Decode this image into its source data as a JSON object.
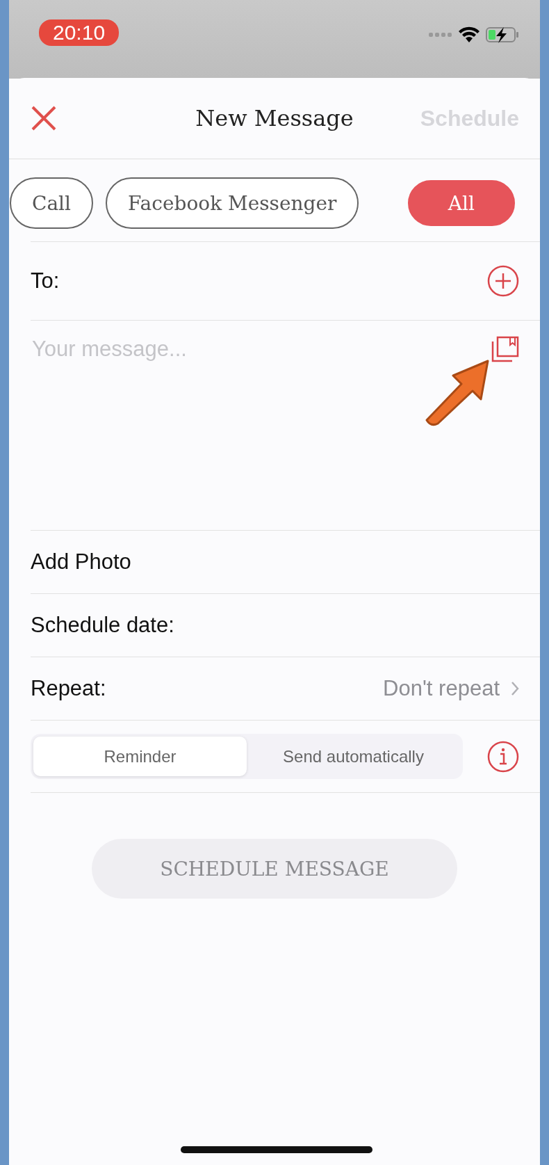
{
  "status_bar": {
    "time": "20:10"
  },
  "header": {
    "title": "New Message",
    "action": "Schedule",
    "action_disabled": true
  },
  "chips": [
    {
      "label": "Call",
      "selected": false
    },
    {
      "label": "Facebook Messenger",
      "selected": false
    },
    {
      "label": "All",
      "selected": true
    }
  ],
  "to": {
    "label": "To:"
  },
  "message": {
    "placeholder": "Your message..."
  },
  "rows": [
    {
      "label": "Add Photo"
    },
    {
      "label": "Schedule date:"
    },
    {
      "label": "Repeat:",
      "value": "Don't repeat"
    }
  ],
  "mode": [
    {
      "label": "Reminder",
      "selected": true
    },
    {
      "label": "Send automatically",
      "selected": false
    }
  ],
  "submit": {
    "label": "SCHEDULE MESSAGE",
    "disabled": true
  }
}
